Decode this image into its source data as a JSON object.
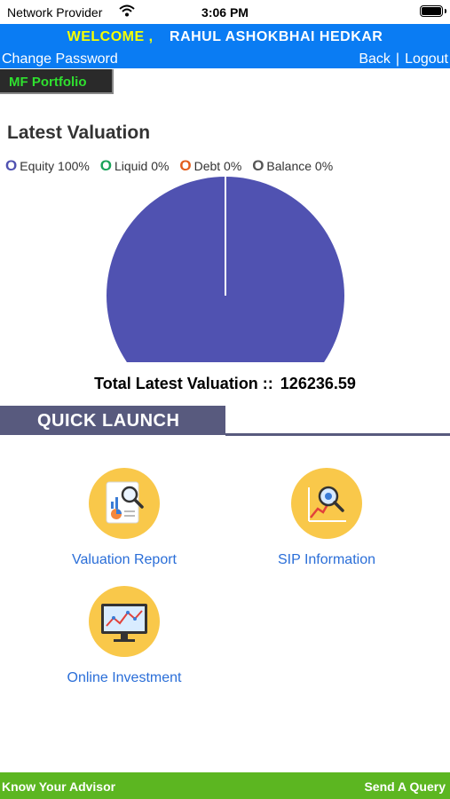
{
  "status_bar": {
    "provider": "Network Provider",
    "time": "3:06 PM"
  },
  "header": {
    "welcome": "WELCOME ,",
    "user_name": "RAHUL ASHOKBHAI HEDKAR",
    "change_password": "Change Password",
    "back": "Back",
    "separator": "|",
    "logout": "Logout",
    "background_color": "#0a7cf3"
  },
  "tab": {
    "label": "MF Portfolio"
  },
  "valuation": {
    "title": "Latest Valuation",
    "legend": [
      {
        "label": "Equity 100%",
        "marker": "O",
        "color": "#5052b1"
      },
      {
        "label": "Liquid 0%",
        "marker": "O",
        "color": "#1aa35a"
      },
      {
        "label": "Debt 0%",
        "marker": "O",
        "color": "#e25d1c"
      },
      {
        "label": "Balance 0%",
        "marker": "O",
        "color": "#555555"
      }
    ],
    "total_label": "Total Latest Valuation ::",
    "total_value": "126236.59"
  },
  "chart_data": {
    "type": "pie",
    "categories": [
      "Equity",
      "Liquid",
      "Debt",
      "Balance"
    ],
    "values": [
      100,
      0,
      0,
      0
    ],
    "colors": [
      "#5052b1",
      "#1aa35a",
      "#e25d1c",
      "#555555"
    ]
  },
  "quick_launch": {
    "title": "QUICK LAUNCH",
    "items": [
      {
        "label": "Valuation Report",
        "icon": "valuation-report-icon"
      },
      {
        "label": "SIP Information",
        "icon": "sip-information-icon"
      },
      {
        "label": "Online Investment",
        "icon": "online-investment-icon"
      }
    ]
  },
  "footer": {
    "left": "Know Your Advisor",
    "right": "Send A Query",
    "background_color": "#5cb621"
  }
}
